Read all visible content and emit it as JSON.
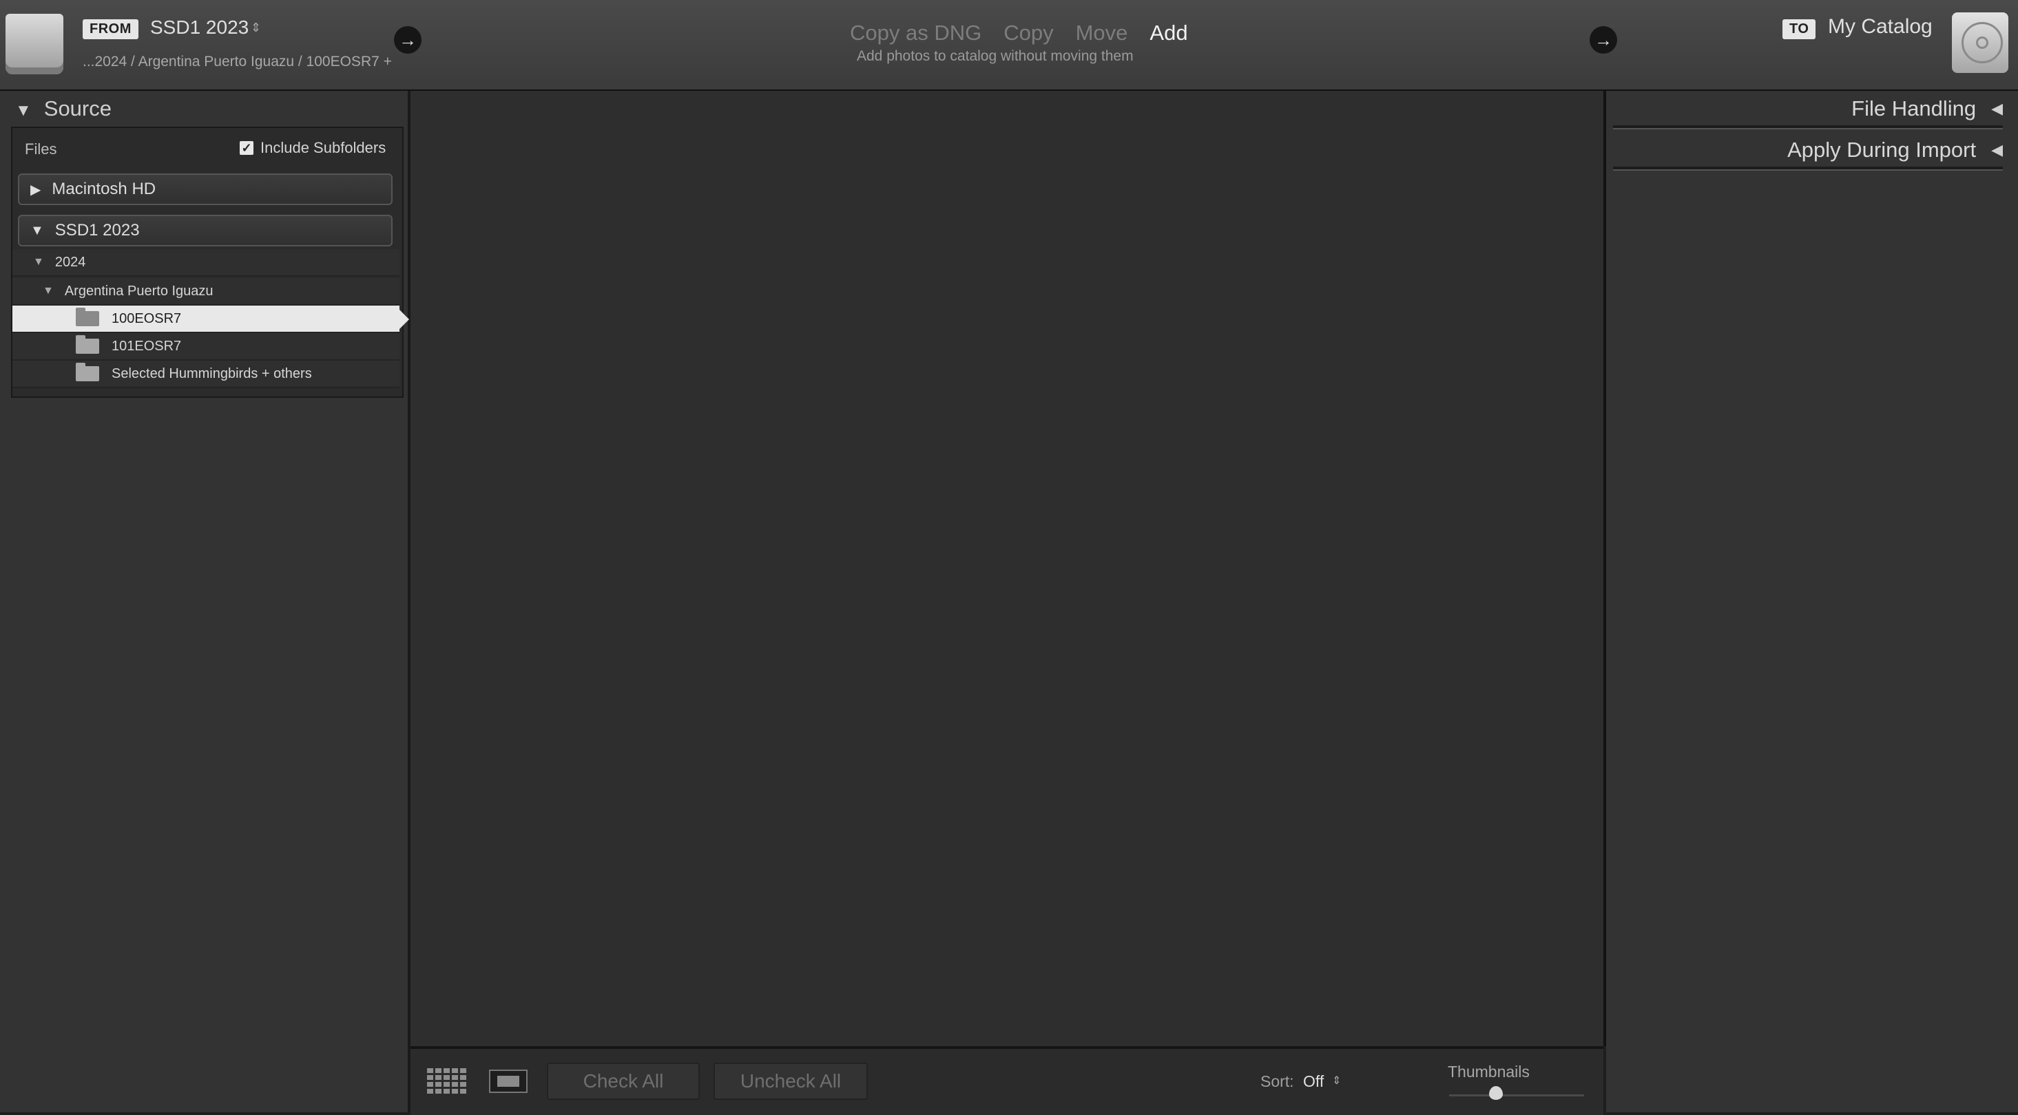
{
  "header": {
    "from_badge": "FROM",
    "source_name": "SSD1 2023",
    "source_dropdown": "⇕",
    "source_path": "...2024 / Argentina Puerto Iguazu / 100EOSR7 +",
    "modes": [
      {
        "label": "Copy as DNG",
        "active": false
      },
      {
        "label": "Copy",
        "active": false
      },
      {
        "label": "Move",
        "active": false
      },
      {
        "label": "Add",
        "active": true
      }
    ],
    "mode_description": "Add photos to catalog without moving them",
    "to_badge": "TO",
    "destination": "My Catalog"
  },
  "source_panel": {
    "title": "Source",
    "files_label": "Files",
    "include_subfolders": "Include Subfolders",
    "volumes": [
      {
        "label": "Macintosh HD",
        "expanded": false
      },
      {
        "label": "SSD1 2023",
        "expanded": true
      }
    ],
    "tree": {
      "year": "2024",
      "event": "Argentina Puerto Iguazu",
      "folders": [
        "100EOSR7",
        "101EOSR7",
        "Selected Hummingbirds + others"
      ],
      "selected_folder": "100EOSR7"
    }
  },
  "toolbar": {
    "check_all": "Check All",
    "uncheck_all": "Uncheck All",
    "sort_label": "Sort:",
    "sort_value": "Off",
    "thumbnails_label": "Thumbnails"
  },
  "right_panel": {
    "file_handling": "File Handling",
    "apply_during_import": "Apply During Import"
  },
  "icons": {
    "collapse": "▼",
    "expand": "▶",
    "panel_toggle": "◀",
    "arrow": "→",
    "check": "✓"
  }
}
